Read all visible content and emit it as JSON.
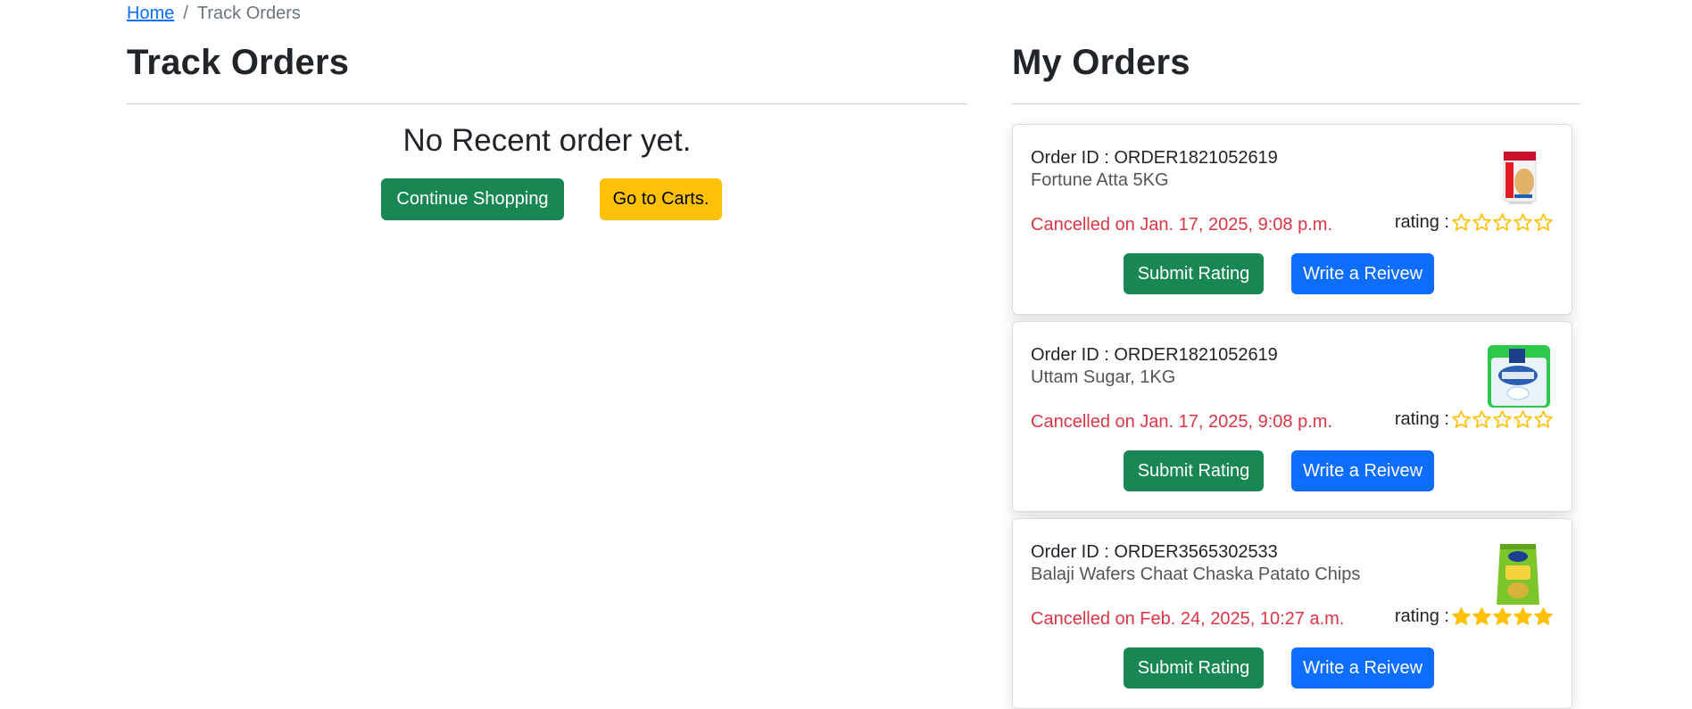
{
  "breadcrumb": {
    "home": "Home",
    "separator": "/",
    "current": "Track Orders"
  },
  "track_orders": {
    "title": "Track Orders",
    "empty_message": "No Recent order yet.",
    "continue_button": "Continue Shopping",
    "carts_button": "Go to Carts."
  },
  "my_orders": {
    "title": "My Orders",
    "orders": [
      {
        "order_id": "Order ID : ORDER1821052619",
        "product": "Fortune Atta 5KG",
        "status": "Cancelled on Jan. 17, 2025, 9:08 p.m.",
        "rating_label": "rating :",
        "rating": 0,
        "image": "fortune-atta-package-icon",
        "submit_button": "Submit Rating",
        "review_button": "Write a Reivew"
      },
      {
        "order_id": "Order ID : ORDER1821052619",
        "product": "Uttam Sugar, 1KG",
        "status": "Cancelled on Jan. 17, 2025, 9:08 p.m.",
        "rating_label": "rating :",
        "rating": 0,
        "image": "uttam-sugar-package-icon",
        "submit_button": "Submit Rating",
        "review_button": "Write a Reivew"
      },
      {
        "order_id": "Order ID : ORDER3565302533",
        "product": "Balaji Wafers Chaat Chaska Patato Chips",
        "status": "Cancelled on Feb. 24, 2025, 10:27 a.m.",
        "rating_label": "rating :",
        "rating": 5,
        "image": "balaji-chips-package-icon",
        "submit_button": "Submit Rating",
        "review_button": "Write a Reivew"
      }
    ]
  },
  "colors": {
    "success": "#198754",
    "warning": "#ffc107",
    "primary": "#0d6efd",
    "danger": "#dc3545",
    "star": "#ffc107",
    "link": "#0d6efd"
  }
}
